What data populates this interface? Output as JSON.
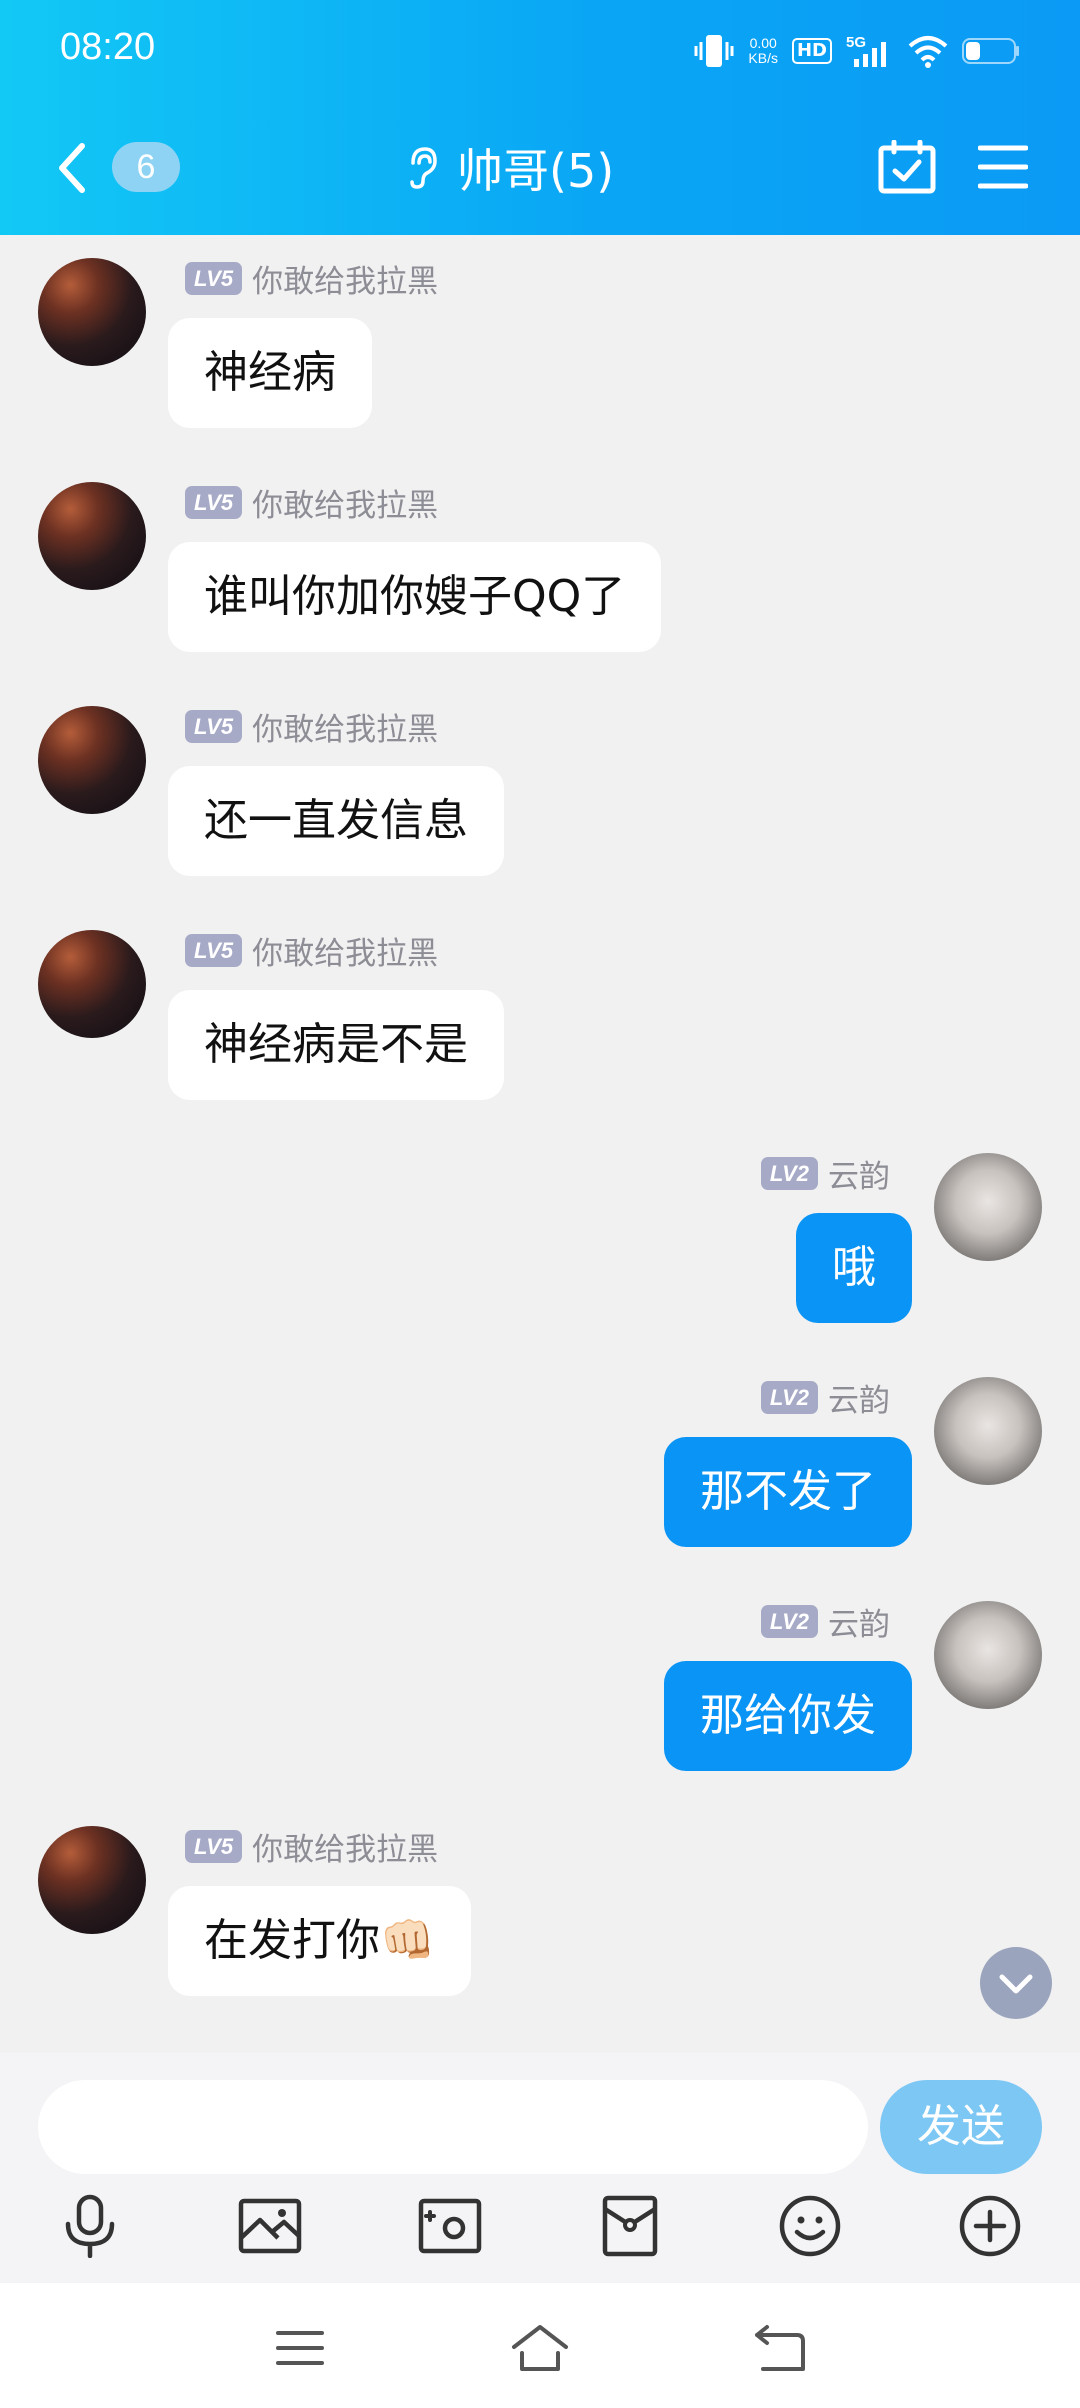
{
  "status": {
    "time": "08:20",
    "speed_value": "0.00",
    "speed_unit": "KB/s",
    "hd": "HD",
    "network": "5G"
  },
  "header": {
    "unread_count": "6",
    "title": "帅哥(5)"
  },
  "messages": [
    {
      "sender": "你敢给我拉黑",
      "level": "LV5",
      "text": "神经病"
    },
    {
      "sender": "你敢给我拉黑",
      "level": "LV5",
      "text": "谁叫你加你嫂子QQ了"
    },
    {
      "sender": "你敢给我拉黑",
      "level": "LV5",
      "text": "还一直发信息"
    },
    {
      "sender": "你敢给我拉黑",
      "level": "LV5",
      "text": "神经病是不是"
    },
    {
      "sender": "云韵",
      "level": "LV2",
      "text": "哦"
    },
    {
      "sender": "云韵",
      "level": "LV2",
      "text": "那不发了"
    },
    {
      "sender": "云韵",
      "level": "LV2",
      "text": "那给你发"
    },
    {
      "sender": "你敢给我拉黑",
      "level": "LV5",
      "text": "在发打你👊🏻"
    }
  ],
  "input": {
    "placeholder": "",
    "send_label": "发送"
  },
  "toolbar": [
    "microphone-icon",
    "image-icon",
    "camera-icon",
    "red-packet-icon",
    "emoji-icon",
    "plus-icon"
  ],
  "colors": {
    "accent": "#0a94f5",
    "header_start": "#12c8f5",
    "send_button": "#7dc7f4",
    "level_badge": "#a6aac6"
  }
}
